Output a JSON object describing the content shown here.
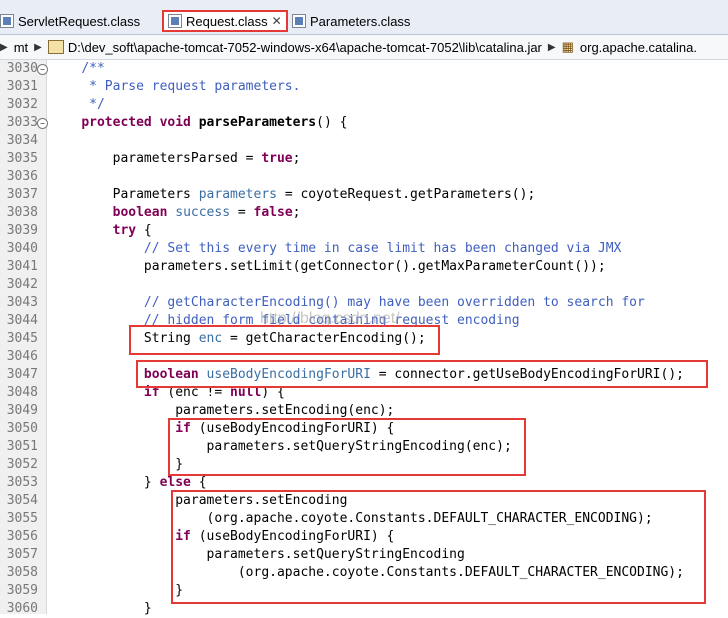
{
  "tabs": [
    {
      "label": "ServletRequest.class"
    },
    {
      "label": "Request.class",
      "close": "✕"
    },
    {
      "label": "Parameters.class"
    }
  ],
  "breadcrumb": {
    "project": "mt",
    "path": "D:\\dev_soft\\apache-tomcat-7052-windows-x64\\apache-tomcat-7052\\lib\\catalina.jar",
    "package": "org.apache.catalina."
  },
  "watermark": "http://blog.csdn.net/",
  "code_lines": [
    {
      "n": "3030",
      "html": "    <span class=\"cm\">/**</span>"
    },
    {
      "n": "3031",
      "html": "     <span class=\"cm\">* Parse request parameters.</span>"
    },
    {
      "n": "3032",
      "html": "     <span class=\"cm\">*/</span>"
    },
    {
      "n": "3033",
      "html": "    <span class=\"kw\">protected void</span> <b>parseParameters</b>() {"
    },
    {
      "n": "3034",
      "html": ""
    },
    {
      "n": "3035",
      "html": "        parametersParsed = <span class=\"kw\">true</span>;"
    },
    {
      "n": "3036",
      "html": ""
    },
    {
      "n": "3037",
      "html": "        Parameters <span class=\"lvar\">parameters</span> = coyoteRequest.getParameters();"
    },
    {
      "n": "3038",
      "html": "        <span class=\"kw\">boolean</span> <span class=\"lvar\">success</span> = <span class=\"kw\">false</span>;"
    },
    {
      "n": "3039",
      "html": "        <span class=\"kw\">try</span> {"
    },
    {
      "n": "3040",
      "html": "            <span class=\"cm\">// Set this every time in case limit has been changed via JMX</span>"
    },
    {
      "n": "3041",
      "html": "            parameters.setLimit(getConnector().getMaxParameterCount());"
    },
    {
      "n": "3042",
      "html": ""
    },
    {
      "n": "3043",
      "html": "            <span class=\"cm\">// getCharacterEncoding() may have been overridden to search for</span>"
    },
    {
      "n": "3044",
      "html": "            <span class=\"cm\">// hidden form field containing request encoding</span>"
    },
    {
      "n": "3045",
      "html": "            String <span class=\"lvar\">enc</span> = getCharacterEncoding();"
    },
    {
      "n": "3046",
      "html": ""
    },
    {
      "n": "3047",
      "html": "            <span class=\"kw\">boolean</span> <span class=\"lvar\">useBodyEncodingForURI</span> = connector.getUseBodyEncodingForURI();"
    },
    {
      "n": "3048",
      "html": "            <span class=\"kw\">if</span> (enc != <span class=\"kw\">null</span>) {"
    },
    {
      "n": "3049",
      "html": "                parameters.setEncoding(enc);"
    },
    {
      "n": "3050",
      "html": "                <span class=\"kw\">if</span> (useBodyEncodingForURI) {"
    },
    {
      "n": "3051",
      "html": "                    parameters.setQueryStringEncoding(enc);"
    },
    {
      "n": "3052",
      "html": "                }"
    },
    {
      "n": "3053",
      "html": "            } <span class=\"kw\">else</span> {"
    },
    {
      "n": "3054",
      "html": "                parameters.setEncoding"
    },
    {
      "n": "3055",
      "html": "                    (org.apache.coyote.Constants.DEFAULT_CHARACTER_ENCODING);"
    },
    {
      "n": "3056",
      "html": "                <span class=\"kw\">if</span> (useBodyEncodingForURI) {"
    },
    {
      "n": "3057",
      "html": "                    parameters.setQueryStringEncoding"
    },
    {
      "n": "3058",
      "html": "                        (org.apache.coyote.Constants.DEFAULT_CHARACTER_ENCODING);"
    },
    {
      "n": "3059",
      "html": "                }"
    },
    {
      "n": "3060",
      "html": "            }"
    }
  ]
}
